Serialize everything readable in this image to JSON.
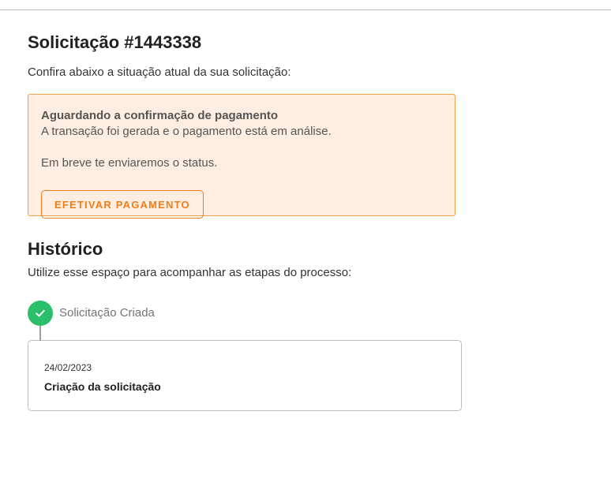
{
  "request": {
    "title": "Solicitação #1443338",
    "subtitle": "Confira abaixo a situação atual da sua solicitação:"
  },
  "status_alert": {
    "title": "Aguardando a confirmação de pagamento",
    "line1": "A transação foi gerada e o pagamento está em análise.",
    "line2": "Em breve te enviaremos o status.",
    "button_label": "EFETIVAR PAGAMENTO",
    "colors": {
      "background": "#fdeee1",
      "border": "#f0a04b",
      "accent": "#ef7d1a"
    }
  },
  "history": {
    "title": "Histórico",
    "subtitle": "Utilize esse espaço para acompanhar as etapas do processo:",
    "steps": [
      {
        "label": "Solicitação Criada",
        "icon": "check-icon",
        "status_color": "#2bbf6a",
        "date": "24/02/2023",
        "description": "Criação da solicitação"
      }
    ]
  }
}
